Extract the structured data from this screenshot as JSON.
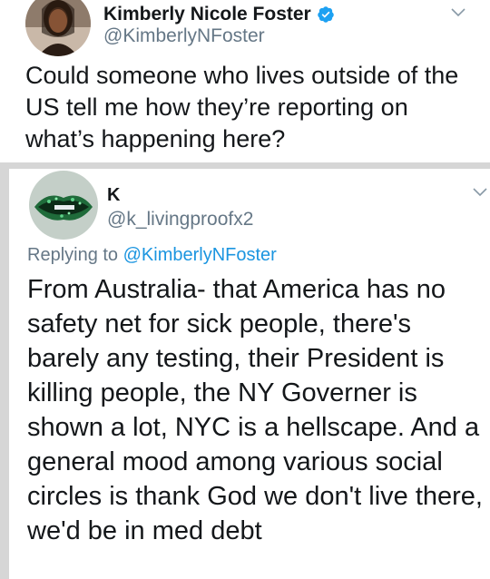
{
  "tweet1": {
    "author_name": "Kimberly Nicole Foster",
    "author_handle": "@KimberlyNFoster",
    "verified": true,
    "text": "Could someone who lives outside of the US tell me how they’re reporting on what’s happening here?"
  },
  "tweet2": {
    "author_name": "K",
    "author_handle": "@k_livingproofx2",
    "replying_prefix": "Replying to ",
    "replying_to": "@KimberlyNFoster",
    "text": "From Australia- that America has no safety net for sick people, there's barely any testing, their President is killing people, the NY Governer is shown a lot, NYC is a hellscape. And a general mood among various social circles is thank God we don't live there, we'd be in med debt"
  },
  "colors": {
    "text": "#14171a",
    "secondary": "#657786",
    "link": "#1b95e0",
    "verified": "#1da1f2"
  },
  "icons": [
    "verified-badge-icon",
    "chevron-down-icon"
  ]
}
